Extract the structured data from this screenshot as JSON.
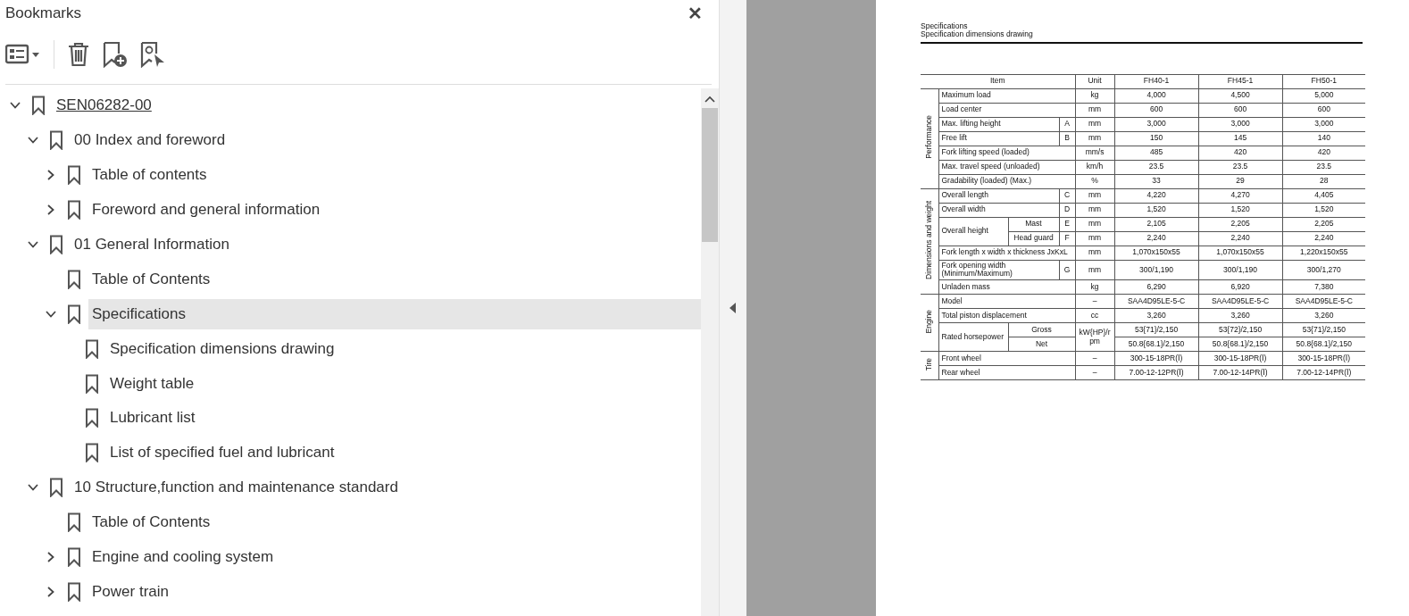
{
  "panel": {
    "title": "Bookmarks",
    "close": "✕"
  },
  "tree": [
    {
      "label": "SEN06282-00",
      "expanded": true,
      "selected": false,
      "children": [
        {
          "label": "00 Index and foreword",
          "expanded": true,
          "selected": false,
          "children": [
            {
              "label": "Table of contents",
              "expanded": false,
              "selected": false
            },
            {
              "label": "Foreword and general information",
              "expanded": false,
              "selected": false
            }
          ]
        },
        {
          "label": "01 General Information",
          "expanded": true,
          "selected": false,
          "children": [
            {
              "label": "Table of Contents",
              "selected": false
            },
            {
              "label": "Specifications",
              "expanded": true,
              "selected": true,
              "children": [
                {
                  "label": "Specification dimensions drawing",
                  "selected": false
                },
                {
                  "label": "Weight table",
                  "selected": false
                },
                {
                  "label": "Lubricant list",
                  "selected": false
                },
                {
                  "label": "List of specified fuel and lubricant",
                  "selected": false
                }
              ]
            }
          ]
        },
        {
          "label": "10 Structure,function and maintenance standard",
          "expanded": true,
          "selected": false,
          "children": [
            {
              "label": "Table of Contents",
              "selected": false
            },
            {
              "label": "Engine and cooling system",
              "expanded": false,
              "selected": false
            },
            {
              "label": "Power train",
              "expanded": false,
              "selected": false
            }
          ]
        }
      ]
    }
  ],
  "document": {
    "heading": "Specifications",
    "subheading": "Specification dimensions drawing",
    "table": {
      "item_header": "Item",
      "unit_header": "Unit",
      "models": [
        "FH40-1",
        "FH45-1",
        "FH50-1"
      ],
      "groups": [
        {
          "label": "Performance",
          "rows": [
            {
              "item": "Maximum load",
              "unit": "kg",
              "values": [
                "4,000",
                "4,500",
                "5,000"
              ]
            },
            {
              "item": "Load center",
              "unit": "mm",
              "values": [
                "600",
                "600",
                "600"
              ]
            },
            {
              "item": "Max. lifting height",
              "letter": "A",
              "unit": "mm",
              "values": [
                "3,000",
                "3,000",
                "3,000"
              ]
            },
            {
              "item": "Free lift",
              "letter": "B",
              "unit": "mm",
              "values": [
                "150",
                "145",
                "140"
              ]
            },
            {
              "item": "Fork lifting speed (loaded)",
              "unit": "mm/s",
              "values": [
                "485",
                "420",
                "420"
              ]
            },
            {
              "item": "Max. travel speed (unloaded)",
              "unit": "km/h",
              "values": [
                "23.5",
                "23.5",
                "23.5"
              ]
            },
            {
              "item": "Gradability (loaded) (Max.)",
              "unit": "%",
              "values": [
                "33",
                "29",
                "28"
              ]
            }
          ]
        },
        {
          "label": "Dimensions and weight",
          "rows": [
            {
              "item": "Overall length",
              "letter": "C",
              "unit": "mm",
              "values": [
                "4,220",
                "4,270",
                "4,405"
              ]
            },
            {
              "item": "Overall width",
              "letter": "D",
              "unit": "mm",
              "values": [
                "1,520",
                "1,520",
                "1,520"
              ]
            },
            {
              "item": "Overall height",
              "sub_rows": [
                {
                  "sub": "Mast",
                  "letter": "E",
                  "unit": "mm",
                  "values": [
                    "2,105",
                    "2,205",
                    "2,205"
                  ]
                },
                {
                  "sub": "Head guard",
                  "letter": "F",
                  "unit": "mm",
                  "values": [
                    "2,240",
                    "2,240",
                    "2,240"
                  ]
                }
              ]
            },
            {
              "item": "Fork length x width x thickness JxKxL",
              "unit": "mm",
              "values": [
                "1,070x150x55",
                "1,070x150x55",
                "1,220x150x55"
              ]
            },
            {
              "item": "Fork opening width (Minimum/Maximum)",
              "letter": "G",
              "unit": "mm",
              "values": [
                "300/1,190",
                "300/1,190",
                "300/1,270"
              ]
            },
            {
              "item": "Unladen mass",
              "unit": "kg",
              "values": [
                "6,290",
                "6,920",
                "7,380"
              ]
            }
          ]
        },
        {
          "label": "Engine",
          "rows": [
            {
              "item": "Model",
              "unit": "–",
              "values": [
                "SAA4D95LE-5-C",
                "SAA4D95LE-5-C",
                "SAA4D95LE-5-C"
              ]
            },
            {
              "item": "Total piston displacement",
              "unit": "cc",
              "values": [
                "3,260",
                "3,260",
                "3,260"
              ]
            },
            {
              "item": "Rated horsepower",
              "unit": "kW{HP}/rpm",
              "sub_rows": [
                {
                  "sub": "Gross",
                  "values": [
                    "53{71}/2,150",
                    "53{72}/2,150",
                    "53{71}/2,150"
                  ]
                },
                {
                  "sub": "Net",
                  "values": [
                    "50.8{68.1}/2,150",
                    "50.8{68.1}/2,150",
                    "50.8{68.1}/2,150"
                  ]
                }
              ]
            }
          ]
        },
        {
          "label": "Tire",
          "rows": [
            {
              "item": "Front wheel",
              "unit": "–",
              "values": [
                "300-15-18PR(Ⅰ)",
                "300-15-18PR(Ⅰ)",
                "300-15-18PR(Ⅰ)"
              ]
            },
            {
              "item": "Rear wheel",
              "unit": "–",
              "values": [
                "7.00-12-12PR(Ⅰ)",
                "7.00-12-14PR(Ⅰ)",
                "7.00-12-14PR(Ⅰ)"
              ]
            }
          ]
        }
      ]
    }
  }
}
